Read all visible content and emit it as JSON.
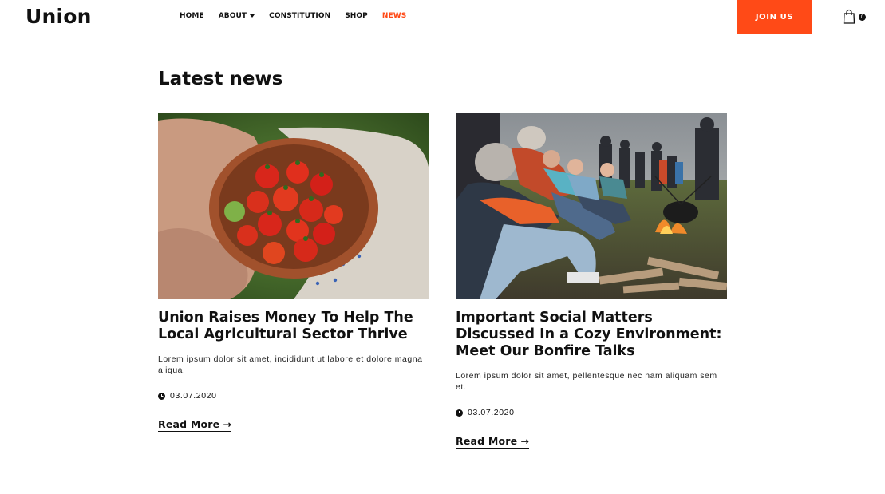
{
  "header": {
    "logo": "Union",
    "nav": [
      {
        "label": "HOME"
      },
      {
        "label": "ABOUT"
      },
      {
        "label": "CONSTITUTION"
      },
      {
        "label": "SHOP"
      },
      {
        "label": "NEWS"
      }
    ],
    "active_nav": "NEWS",
    "join_label": "JOIN US",
    "cart_count": "0",
    "accent_color": "#ff4a17"
  },
  "main": {
    "title": "Latest news",
    "posts": [
      {
        "title": "Union Raises Money To Help The Local Agricultural Sector Thrive",
        "excerpt": "Lorem ipsum dolor sit amet, incididunt ut labore et dolore magna aliqua.",
        "date": "03.07.2020",
        "read_more": "Read More",
        "image": "photo-hands-bowl-of-tomatoes"
      },
      {
        "title": "Important Social Matters Discussed In a Cozy Environment: Meet Our Bonfire Talks",
        "excerpt": "Lorem ipsum dolor sit amet, pellentesque nec nam aliquam sem et.",
        "date": "03.07.2020",
        "read_more": "Read More",
        "image": "photo-people-around-bonfire"
      }
    ]
  }
}
